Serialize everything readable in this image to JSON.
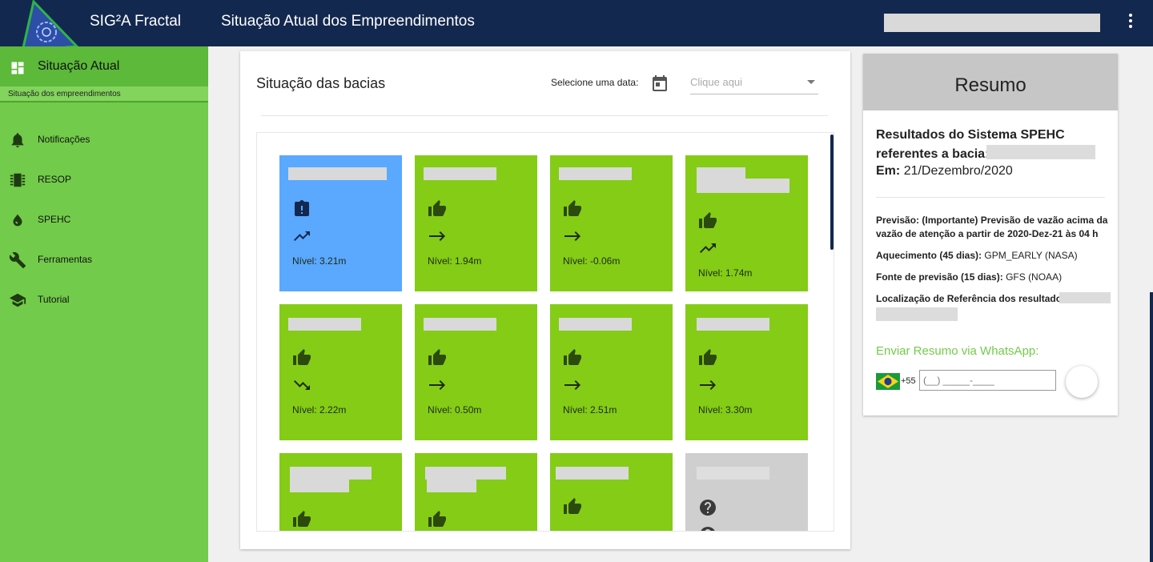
{
  "colors": {
    "topbar": "#13284f",
    "sidebar": "#72cb4a",
    "tile_green": "#84cc16",
    "tile_blue": "#5aa8ff",
    "tile_gray": "#cfcfcf",
    "accent_green": "#72cb4a"
  },
  "header": {
    "app_name": "SIG²A Fractal",
    "page_title": "Situação Atual dos Empreendimentos",
    "logo_icon": "gear-bulb-logo",
    "menu_icon": "more-vert-icon"
  },
  "sidebar": {
    "active": {
      "label": "Situação Atual",
      "sub_label": "Situação dos empreendimentos",
      "icon": "dashboard-icon"
    },
    "items": [
      {
        "label": "Notificações",
        "icon": "bell-icon"
      },
      {
        "label": "RESOP",
        "icon": "chip-icon"
      },
      {
        "label": "SPEHC",
        "icon": "water-icon"
      },
      {
        "label": "Ferramentas",
        "icon": "wrench-icon"
      },
      {
        "label": "Tutorial",
        "icon": "school-icon"
      }
    ]
  },
  "main": {
    "title": "Situação das bacias",
    "date_label": "Selecione uma data:",
    "date_placeholder": "Clique aqui",
    "tiles": [
      {
        "color": "blue",
        "status": "alert-icon",
        "trend": "trend-up-icon",
        "level": "Nível: 3.21m"
      },
      {
        "color": "green",
        "status": "thumb-up-icon",
        "trend": "arrow-right-icon",
        "level": "Nível: 1.94m"
      },
      {
        "color": "green",
        "status": "thumb-up-icon",
        "trend": "arrow-right-icon",
        "level": "Nível: -0.06m"
      },
      {
        "color": "green",
        "status": "thumb-up-icon",
        "trend": "trend-up-icon",
        "level": "Nível: 1.74m"
      },
      {
        "color": "green",
        "status": "thumb-up-icon",
        "trend": "trend-down-icon",
        "level": "Nível: 2.22m"
      },
      {
        "color": "green",
        "status": "thumb-up-icon",
        "trend": "arrow-right-icon",
        "level": "Nível: 0.50m"
      },
      {
        "color": "green",
        "status": "thumb-up-icon",
        "trend": "arrow-right-icon",
        "level": "Nível: 2.51m"
      },
      {
        "color": "green",
        "status": "thumb-up-icon",
        "trend": "arrow-right-icon",
        "level": "Nível: 3.30m"
      },
      {
        "color": "green",
        "status": "thumb-up-icon",
        "trend": "",
        "level": ""
      },
      {
        "color": "green",
        "status": "thumb-up-icon",
        "trend": "",
        "level": ""
      },
      {
        "color": "green",
        "status": "thumb-up-icon",
        "trend": "",
        "level": ""
      },
      {
        "color": "gray",
        "status": "help-icon",
        "trend": "help-icon",
        "level": ""
      }
    ]
  },
  "summary": {
    "title": "Resumo",
    "results_heading": "Resultados do Sistema SPEHC referentes a bacia:",
    "date_prefix": "Em:",
    "date_value": "21/Dezembro/2020",
    "forecast_label": "Previsão:",
    "forecast_text": "(Importante) Previsão de vazão acima da vazão de atenção a partir de 2020-Dez-21 às 04 h",
    "warmup_label": "Aquecimento (45 dias):",
    "warmup_value": "GPM_EARLY (NASA)",
    "source_label": "Fonte de previsão (15 dias):",
    "source_value": "GFS (NOAA)",
    "location_label": "Localização de Referência dos resultados:",
    "whatsapp_label": "Enviar Resumo via WhatsApp:",
    "country_code": "+55",
    "phone_placeholder": "(__) _____-____"
  }
}
